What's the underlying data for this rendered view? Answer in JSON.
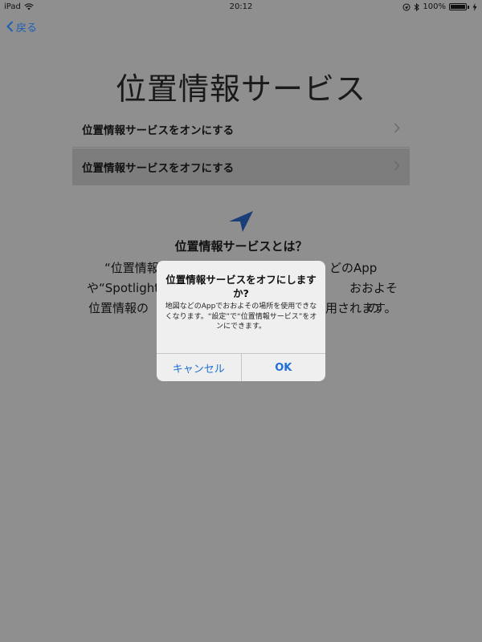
{
  "status_bar": {
    "device": "iPad",
    "time": "20:12",
    "battery": "100%"
  },
  "nav": {
    "back_label": "戻る"
  },
  "page": {
    "title": "位置情報サービス",
    "rows": [
      {
        "label": "位置情報サービスをオンにする"
      },
      {
        "label": "位置情報サービスをオフにする"
      }
    ],
    "about_title": "位置情報サービスとは？",
    "about_lines": [
      "“位置情報",
      "どのApp",
      "や“Spotlight",
      "おおよその",
      "位置情報の",
      "用されます。"
    ]
  },
  "alert": {
    "title": "位置情報サービスをオフにしますか?",
    "message": "地図などのAppでおおよその場所を使用できなくなります。“設定”で“位置情報サービス”をオンにできます。",
    "cancel_label": "キャンセル",
    "ok_label": "OK"
  },
  "colors": {
    "accent": "#1d70d6",
    "dim_background": "#8f8f8f"
  }
}
